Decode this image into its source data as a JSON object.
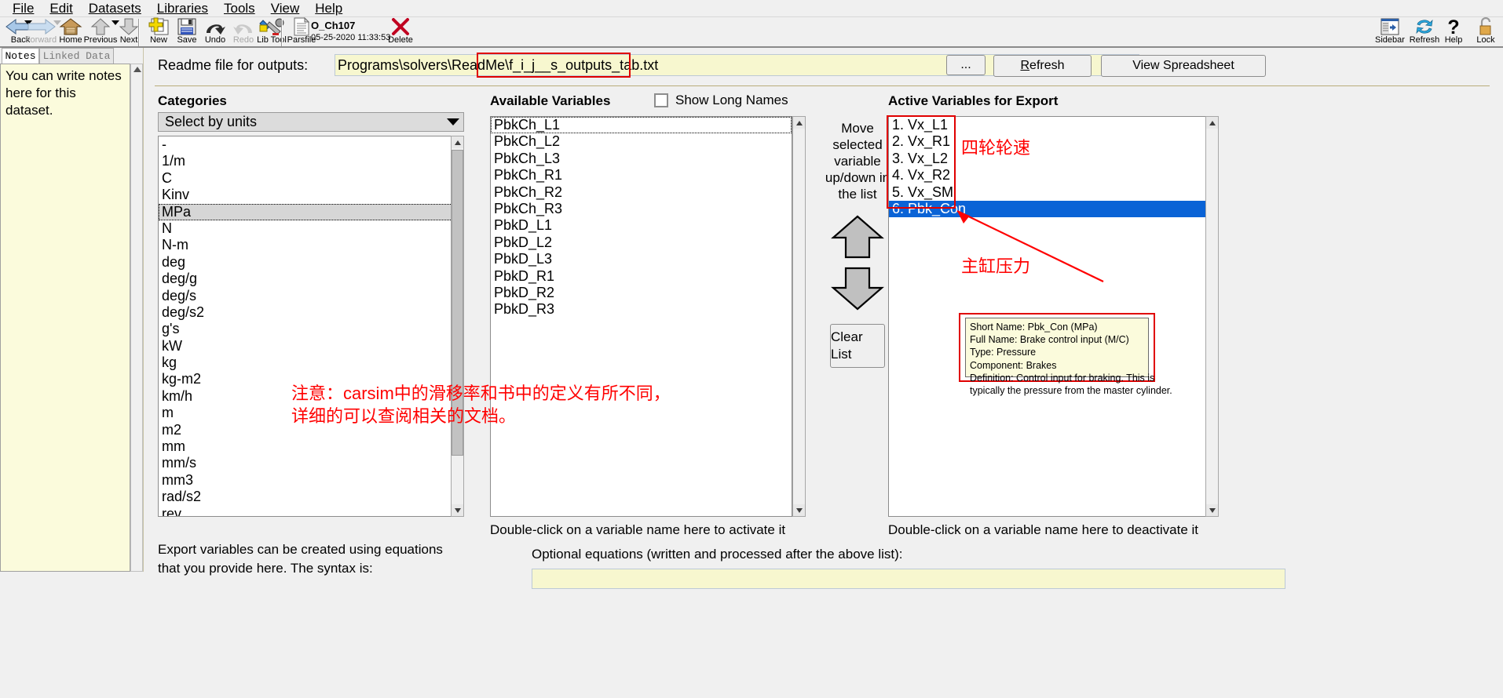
{
  "menu": {
    "items": [
      {
        "label": "File",
        "accel": "F"
      },
      {
        "label": "Edit",
        "accel": "E"
      },
      {
        "label": "Datasets",
        "accel": "D"
      },
      {
        "label": "Libraries",
        "accel": "L"
      },
      {
        "label": "Tools",
        "accel": "T"
      },
      {
        "label": "View",
        "accel": "V"
      },
      {
        "label": "Help",
        "accel": "H"
      }
    ]
  },
  "toolbar": {
    "items": [
      {
        "label": "Back",
        "icon": "back-arrow-icon",
        "enabled": true,
        "dropdown": true
      },
      {
        "label": "Forward",
        "icon": "forward-arrow-icon",
        "enabled": false,
        "dropdown": true
      },
      {
        "label": "Home",
        "icon": "home-icon",
        "enabled": true,
        "dropdown": false
      },
      {
        "label": "Previous",
        "icon": "up-arrow-icon",
        "enabled": true,
        "dropdown": true
      },
      {
        "label": "Next",
        "icon": "down-arrow-icon",
        "enabled": true,
        "dropdown": false
      },
      {
        "label": "New",
        "icon": "new-document-icon",
        "enabled": true,
        "dropdown": false
      },
      {
        "label": "Save",
        "icon": "floppy-disk-icon",
        "enabled": true,
        "dropdown": false
      },
      {
        "label": "Undo",
        "icon": "undo-arrow-icon",
        "enabled": true,
        "dropdown": false
      },
      {
        "label": "Redo",
        "icon": "redo-arrow-icon",
        "enabled": false,
        "dropdown": false
      },
      {
        "label": "Lib Tool",
        "icon": "wrench-icon",
        "enabled": true,
        "dropdown": false
      },
      {
        "label": "Parsfile",
        "icon": "parsfile-document-icon",
        "enabled": true,
        "dropdown": false
      }
    ],
    "dataset_name": "O_Ch107",
    "dataset_date": "05-25-2020 11:33:53",
    "delete_label": "Delete",
    "delete_icon": "red-x-icon",
    "right_items": [
      {
        "label": "Sidebar",
        "icon": "sidebar-icon"
      },
      {
        "label": "Refresh",
        "icon": "refresh-icon"
      },
      {
        "label": "Help",
        "icon": "question-mark-icon"
      },
      {
        "label": "Lock",
        "icon": "padlock-icon"
      }
    ]
  },
  "left_panel": {
    "tabs": [
      {
        "label": "Notes",
        "active": true
      },
      {
        "label": "Linked Data",
        "active": false
      }
    ],
    "notes_text": "You can write notes here for this dataset."
  },
  "readme": {
    "label": "Readme file for outputs:",
    "path_prefix": "Programs\\solvers\\ReadMe\\",
    "path_highlight": "f_i_j__s_outputs_tab.txt",
    "browse_label": "...",
    "refresh_label": "Refresh",
    "refresh_accel": "R",
    "view_spreadsheet_label": "View Spreadsheet"
  },
  "categories": {
    "title": "Categories",
    "selector_value": "Select by units",
    "selected_unit": "MPa",
    "units": [
      "-",
      "1/m",
      "C",
      "Kinv",
      "MPa",
      "N",
      "N-m",
      "deg",
      "deg/g",
      "deg/s",
      "deg/s2",
      "g's",
      "kW",
      "kg",
      "kg-m2",
      "km/h",
      "m",
      "m2",
      "mm",
      "mm/s",
      "mm3",
      "rad/s2",
      "rev"
    ]
  },
  "available": {
    "title": "Available Variables",
    "show_long_names_label": "Show Long Names",
    "show_long_names_checked": false,
    "variables": [
      "PbkCh_L1",
      "PbkCh_L2",
      "PbkCh_L3",
      "PbkCh_R1",
      "PbkCh_R2",
      "PbkCh_R3",
      "PbkD_L1",
      "PbkD_L2",
      "PbkD_L3",
      "PbkD_R1",
      "PbkD_R2",
      "PbkD_R3"
    ],
    "focused_variable": "PbkCh_L1",
    "hint": "Double-click on a variable name here to activate it"
  },
  "move": {
    "text": "Move selected variable up/down in the list",
    "up_icon": "up-arrow-icon",
    "down_icon": "down-arrow-icon",
    "clear_list_label": "Clear List"
  },
  "active": {
    "title": "Active Variables for Export",
    "variables": [
      {
        "index": "1.",
        "name": "Vx_L1",
        "selected": false
      },
      {
        "index": "2.",
        "name": "Vx_R1",
        "selected": false
      },
      {
        "index": "3.",
        "name": "Vx_L2",
        "selected": false
      },
      {
        "index": "4.",
        "name": "Vx_R2",
        "selected": false
      },
      {
        "index": "5.",
        "name": "Vx_SM",
        "selected": false
      },
      {
        "index": "6.",
        "name": "Pbk_Con",
        "selected": true
      }
    ],
    "hint": "Double-click on a variable name here to deactivate it"
  },
  "tooltip": {
    "lines": [
      "Short Name: Pbk_Con (MPa)",
      "Full Name: Brake control input (M/C)",
      "Type: Pressure",
      "Component: Brakes",
      "Definition: Control input for braking. This is",
      "typically the pressure from the master cylinder."
    ]
  },
  "annotations": {
    "wheel_speed_note": "四轮轮速",
    "master_cylinder_note": "主缸压力",
    "slip_note_line1": "注意：carsim中的滑移率和书中的定义有所不同，",
    "slip_note_line2": "详细的可以查阅相关的文档。",
    "color": "#ff0000"
  },
  "bottom": {
    "export_text_line1": "Export variables can be created using equations",
    "export_text_line2": "that you provide here. The syntax is:",
    "optional_equations_label": "Optional equations (written and processed after the above list):"
  }
}
